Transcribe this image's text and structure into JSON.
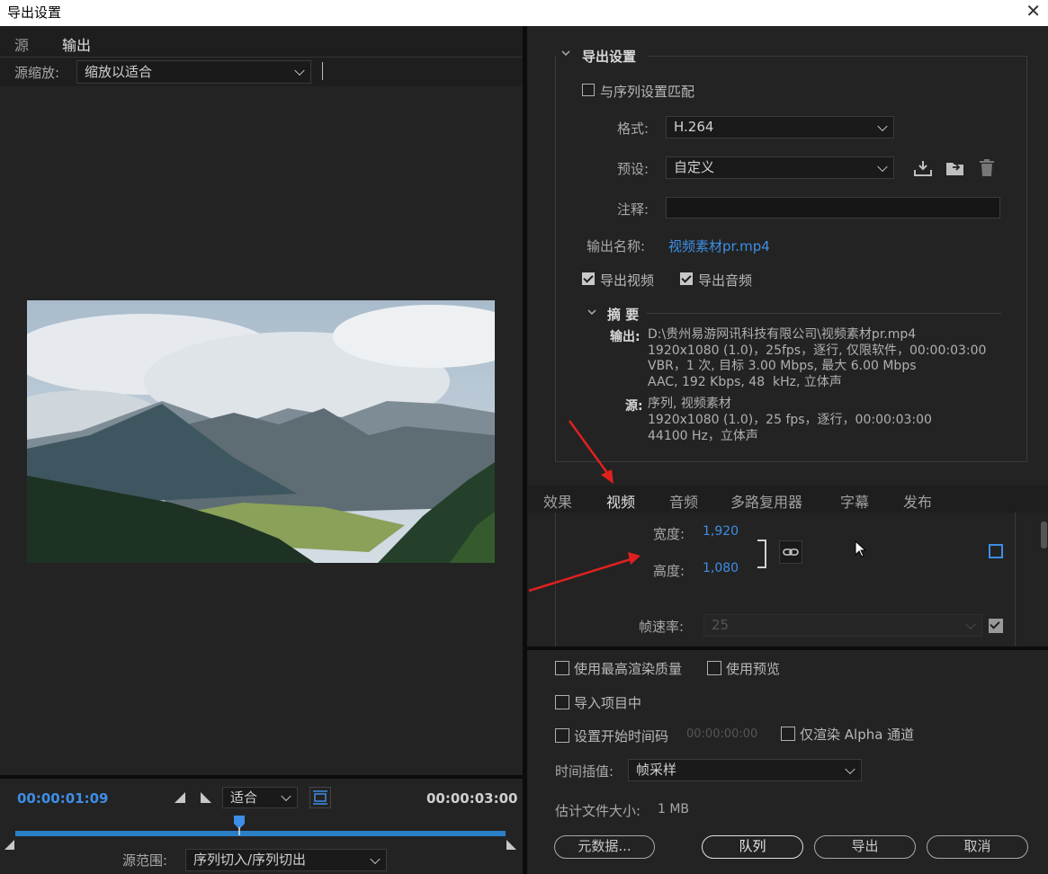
{
  "window": {
    "title": "导出设置",
    "close": "✕"
  },
  "left": {
    "tabs": [
      "源",
      "输出"
    ],
    "scale_label": "源缩放:",
    "scale_value": "缩放以适合",
    "current_time": "00:00:01:09",
    "end_time": "00:00:03:00",
    "fit_value": "适合",
    "range_label": "源范围:",
    "range_value": "序列切入/序列切出",
    "playhead_fraction": 0.457
  },
  "export_settings": {
    "section_title": "导出设置",
    "match_sequence": "与序列设置匹配",
    "format_label": "格式:",
    "format_value": "H.264",
    "preset_label": "预设:",
    "preset_value": "自定义",
    "comment_label": "注释:",
    "comment_value": "",
    "output_name_label": "输出名称:",
    "output_name_value": "视频素材pr.mp4",
    "export_video": "导出视频",
    "export_audio": "导出音频"
  },
  "summary": {
    "title": "摘 要",
    "output_label": "输出:",
    "output_lines": [
      "D:\\贵州易游网讯科技有限公司\\视频素材pr.mp4",
      "1920x1080 (1.0)，25fps，逐行, 仅限软件，00:00:03:00",
      "VBR，1 次, 目标 3.00 Mbps, 最大 6.00 Mbps",
      "AAC, 192 Kbps, 48  kHz, 立体声"
    ],
    "source_label": "源:",
    "source_lines": [
      "序列, 视频素材",
      "1920x1080 (1.0)，25 fps，逐行，00:00:03:00",
      "44100 Hz，立体声"
    ]
  },
  "tabs": [
    "效果",
    "视频",
    "音频",
    "多路复用器",
    "字幕",
    "发布"
  ],
  "video": {
    "width_label": "宽度:",
    "width_value": "1,920",
    "height_label": "高度:",
    "height_value": "1,080",
    "framerate_label": "帧速率:",
    "framerate_value": "25"
  },
  "options": {
    "max_quality": "使用最高渲染质量",
    "use_preview": "使用预览",
    "import_project": "导入项目中",
    "set_start_timecode": "设置开始时间码",
    "start_timecode_value": "00:00:00:00",
    "render_alpha": "仅渲染 Alpha 通道",
    "interp_label": "时间插值:",
    "interp_value": "帧采样",
    "filesize_label": "估计文件大小:",
    "filesize_value": "1 MB"
  },
  "buttons": {
    "metadata": "元数据...",
    "queue": "队列",
    "export": "导出",
    "cancel": "取消"
  },
  "colors": {
    "accent": "#3d8ee6",
    "annotation_arrow": "#e02020"
  },
  "icons": [
    "import-preset-icon",
    "save-preset-icon",
    "delete-preset-icon",
    "link-icon",
    "fit-frame-icon",
    "mark-in-icon",
    "mark-out-icon",
    "playhead-icon"
  ]
}
